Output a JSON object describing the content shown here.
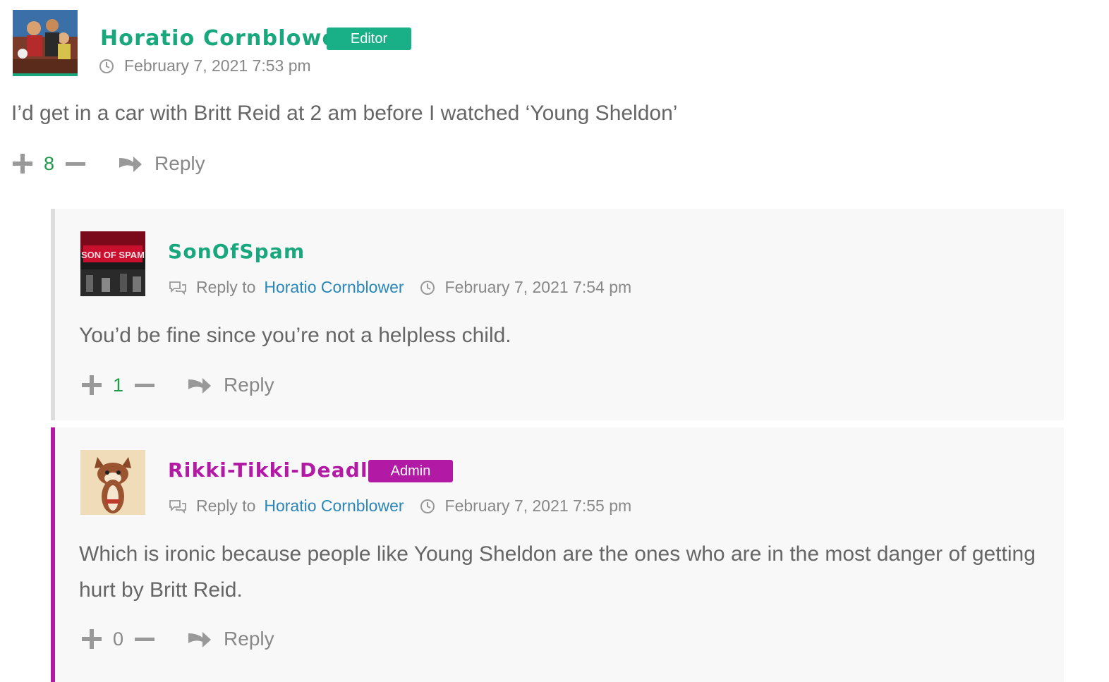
{
  "colors": {
    "editor": "#19a77e",
    "admin": "#b21aa5",
    "link": "#2a86b8",
    "vote_positive": "#1f9b4a",
    "vote_zero": "#888888",
    "reply_border_grey": "#dddddd",
    "reply_border_admin": "#b21aa5"
  },
  "comments": [
    {
      "author": "Horatio Cornblower",
      "role_badge": "Editor",
      "timestamp": "February 7, 2021 7:53 pm",
      "text": "I’d get in a car with Britt Reid at 2 am before I watched ‘Young Sheldon’",
      "votes": "8",
      "reply_label": "Reply",
      "avatar_icon": "illustrated-group-avatar",
      "replies": [
        {
          "author": "SonOfSpam",
          "reply_to_label": "Reply to",
          "reply_to_author": "Horatio Cornblower",
          "timestamp": "February 7, 2021 7:54 pm",
          "text": "You’d be fine since you’re not a helpless child.",
          "votes": "1",
          "reply_label": "Reply",
          "avatar_icon": "neon-sign-avatar",
          "avatar_text": "SON OF SPAM"
        },
        {
          "author": "Rikki-Tikki-Deadly",
          "role_badge": "Admin",
          "reply_to_label": "Reply to",
          "reply_to_author": "Horatio Cornblower",
          "timestamp": "February 7, 2021 7:55 pm",
          "text": "Which is ironic because people like Young Sheldon are the ones who are in the most danger of getting hurt by Britt Reid.",
          "votes": "0",
          "reply_label": "Reply",
          "avatar_icon": "cartoon-mongoose-avatar"
        }
      ]
    }
  ]
}
